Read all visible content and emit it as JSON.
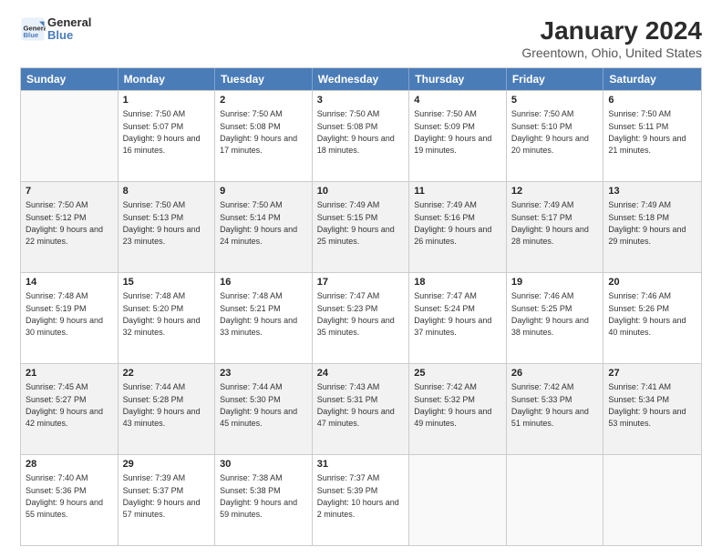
{
  "header": {
    "logo_general": "General",
    "logo_blue": "Blue",
    "month_title": "January 2024",
    "location": "Greentown, Ohio, United States"
  },
  "weekdays": [
    "Sunday",
    "Monday",
    "Tuesday",
    "Wednesday",
    "Thursday",
    "Friday",
    "Saturday"
  ],
  "rows": [
    [
      {
        "empty": true,
        "shaded": false
      },
      {
        "day": "1",
        "sunrise": "Sunrise: 7:50 AM",
        "sunset": "Sunset: 5:07 PM",
        "daylight": "Daylight: 9 hours and 16 minutes.",
        "shaded": false
      },
      {
        "day": "2",
        "sunrise": "Sunrise: 7:50 AM",
        "sunset": "Sunset: 5:08 PM",
        "daylight": "Daylight: 9 hours and 17 minutes.",
        "shaded": false
      },
      {
        "day": "3",
        "sunrise": "Sunrise: 7:50 AM",
        "sunset": "Sunset: 5:08 PM",
        "daylight": "Daylight: 9 hours and 18 minutes.",
        "shaded": false
      },
      {
        "day": "4",
        "sunrise": "Sunrise: 7:50 AM",
        "sunset": "Sunset: 5:09 PM",
        "daylight": "Daylight: 9 hours and 19 minutes.",
        "shaded": false
      },
      {
        "day": "5",
        "sunrise": "Sunrise: 7:50 AM",
        "sunset": "Sunset: 5:10 PM",
        "daylight": "Daylight: 9 hours and 20 minutes.",
        "shaded": false
      },
      {
        "day": "6",
        "sunrise": "Sunrise: 7:50 AM",
        "sunset": "Sunset: 5:11 PM",
        "daylight": "Daylight: 9 hours and 21 minutes.",
        "shaded": false
      }
    ],
    [
      {
        "day": "7",
        "sunrise": "Sunrise: 7:50 AM",
        "sunset": "Sunset: 5:12 PM",
        "daylight": "Daylight: 9 hours and 22 minutes.",
        "shaded": true
      },
      {
        "day": "8",
        "sunrise": "Sunrise: 7:50 AM",
        "sunset": "Sunset: 5:13 PM",
        "daylight": "Daylight: 9 hours and 23 minutes.",
        "shaded": true
      },
      {
        "day": "9",
        "sunrise": "Sunrise: 7:50 AM",
        "sunset": "Sunset: 5:14 PM",
        "daylight": "Daylight: 9 hours and 24 minutes.",
        "shaded": true
      },
      {
        "day": "10",
        "sunrise": "Sunrise: 7:49 AM",
        "sunset": "Sunset: 5:15 PM",
        "daylight": "Daylight: 9 hours and 25 minutes.",
        "shaded": true
      },
      {
        "day": "11",
        "sunrise": "Sunrise: 7:49 AM",
        "sunset": "Sunset: 5:16 PM",
        "daylight": "Daylight: 9 hours and 26 minutes.",
        "shaded": true
      },
      {
        "day": "12",
        "sunrise": "Sunrise: 7:49 AM",
        "sunset": "Sunset: 5:17 PM",
        "daylight": "Daylight: 9 hours and 28 minutes.",
        "shaded": true
      },
      {
        "day": "13",
        "sunrise": "Sunrise: 7:49 AM",
        "sunset": "Sunset: 5:18 PM",
        "daylight": "Daylight: 9 hours and 29 minutes.",
        "shaded": true
      }
    ],
    [
      {
        "day": "14",
        "sunrise": "Sunrise: 7:48 AM",
        "sunset": "Sunset: 5:19 PM",
        "daylight": "Daylight: 9 hours and 30 minutes.",
        "shaded": false
      },
      {
        "day": "15",
        "sunrise": "Sunrise: 7:48 AM",
        "sunset": "Sunset: 5:20 PM",
        "daylight": "Daylight: 9 hours and 32 minutes.",
        "shaded": false
      },
      {
        "day": "16",
        "sunrise": "Sunrise: 7:48 AM",
        "sunset": "Sunset: 5:21 PM",
        "daylight": "Daylight: 9 hours and 33 minutes.",
        "shaded": false
      },
      {
        "day": "17",
        "sunrise": "Sunrise: 7:47 AM",
        "sunset": "Sunset: 5:23 PM",
        "daylight": "Daylight: 9 hours and 35 minutes.",
        "shaded": false
      },
      {
        "day": "18",
        "sunrise": "Sunrise: 7:47 AM",
        "sunset": "Sunset: 5:24 PM",
        "daylight": "Daylight: 9 hours and 37 minutes.",
        "shaded": false
      },
      {
        "day": "19",
        "sunrise": "Sunrise: 7:46 AM",
        "sunset": "Sunset: 5:25 PM",
        "daylight": "Daylight: 9 hours and 38 minutes.",
        "shaded": false
      },
      {
        "day": "20",
        "sunrise": "Sunrise: 7:46 AM",
        "sunset": "Sunset: 5:26 PM",
        "daylight": "Daylight: 9 hours and 40 minutes.",
        "shaded": false
      }
    ],
    [
      {
        "day": "21",
        "sunrise": "Sunrise: 7:45 AM",
        "sunset": "Sunset: 5:27 PM",
        "daylight": "Daylight: 9 hours and 42 minutes.",
        "shaded": true
      },
      {
        "day": "22",
        "sunrise": "Sunrise: 7:44 AM",
        "sunset": "Sunset: 5:28 PM",
        "daylight": "Daylight: 9 hours and 43 minutes.",
        "shaded": true
      },
      {
        "day": "23",
        "sunrise": "Sunrise: 7:44 AM",
        "sunset": "Sunset: 5:30 PM",
        "daylight": "Daylight: 9 hours and 45 minutes.",
        "shaded": true
      },
      {
        "day": "24",
        "sunrise": "Sunrise: 7:43 AM",
        "sunset": "Sunset: 5:31 PM",
        "daylight": "Daylight: 9 hours and 47 minutes.",
        "shaded": true
      },
      {
        "day": "25",
        "sunrise": "Sunrise: 7:42 AM",
        "sunset": "Sunset: 5:32 PM",
        "daylight": "Daylight: 9 hours and 49 minutes.",
        "shaded": true
      },
      {
        "day": "26",
        "sunrise": "Sunrise: 7:42 AM",
        "sunset": "Sunset: 5:33 PM",
        "daylight": "Daylight: 9 hours and 51 minutes.",
        "shaded": true
      },
      {
        "day": "27",
        "sunrise": "Sunrise: 7:41 AM",
        "sunset": "Sunset: 5:34 PM",
        "daylight": "Daylight: 9 hours and 53 minutes.",
        "shaded": true
      }
    ],
    [
      {
        "day": "28",
        "sunrise": "Sunrise: 7:40 AM",
        "sunset": "Sunset: 5:36 PM",
        "daylight": "Daylight: 9 hours and 55 minutes.",
        "shaded": false
      },
      {
        "day": "29",
        "sunrise": "Sunrise: 7:39 AM",
        "sunset": "Sunset: 5:37 PM",
        "daylight": "Daylight: 9 hours and 57 minutes.",
        "shaded": false
      },
      {
        "day": "30",
        "sunrise": "Sunrise: 7:38 AM",
        "sunset": "Sunset: 5:38 PM",
        "daylight": "Daylight: 9 hours and 59 minutes.",
        "shaded": false
      },
      {
        "day": "31",
        "sunrise": "Sunrise: 7:37 AM",
        "sunset": "Sunset: 5:39 PM",
        "daylight": "Daylight: 10 hours and 2 minutes.",
        "shaded": false
      },
      {
        "empty": true,
        "shaded": false
      },
      {
        "empty": true,
        "shaded": false
      },
      {
        "empty": true,
        "shaded": false
      }
    ]
  ]
}
